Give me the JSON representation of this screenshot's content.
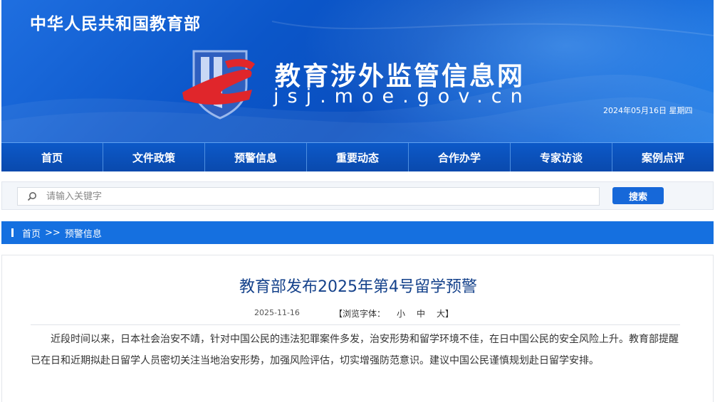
{
  "header": {
    "ministry": "中华人民共和国教育部",
    "site_title": "教育涉外监管信息网",
    "site_domain": "jsj.moe.gov.cn",
    "date": "2024年05月16日  星期四",
    "logo_icon": "js-shield-logo-icon"
  },
  "nav": {
    "items": [
      {
        "label": "首页"
      },
      {
        "label": "文件政策"
      },
      {
        "label": "预警信息"
      },
      {
        "label": "重要动态"
      },
      {
        "label": "合作办学"
      },
      {
        "label": "专家访谈"
      },
      {
        "label": "案例点评"
      }
    ]
  },
  "search": {
    "icon": "search-icon",
    "placeholder": "请输入关键字",
    "value": "",
    "button_label": "搜索"
  },
  "breadcrumb": {
    "home": "首页",
    "separator": ">>",
    "current": "预警信息"
  },
  "article": {
    "title": "教育部发布2025年第4号留学预警",
    "date": "2025-11-16",
    "font_label": "【浏览字体：",
    "font_small": "小",
    "font_medium": "中",
    "font_large": "大】",
    "body": "近段时间以来，日本社会治安不靖，针对中国公民的违法犯罪案件多发，治安形势和留学环境不佳，在日中国公民的安全风险上升。教育部提醒已在日和近期拟赴日留学人员密切关注当地治安形势，加强风险评估，切实增强防范意识。建议中国公民谨慎规划赴日留学安排。"
  },
  "colors": {
    "nav_bg": "#0a4fb6",
    "accent": "#1570e0",
    "title_color": "#15428b",
    "logo_red": "#e0262b"
  }
}
